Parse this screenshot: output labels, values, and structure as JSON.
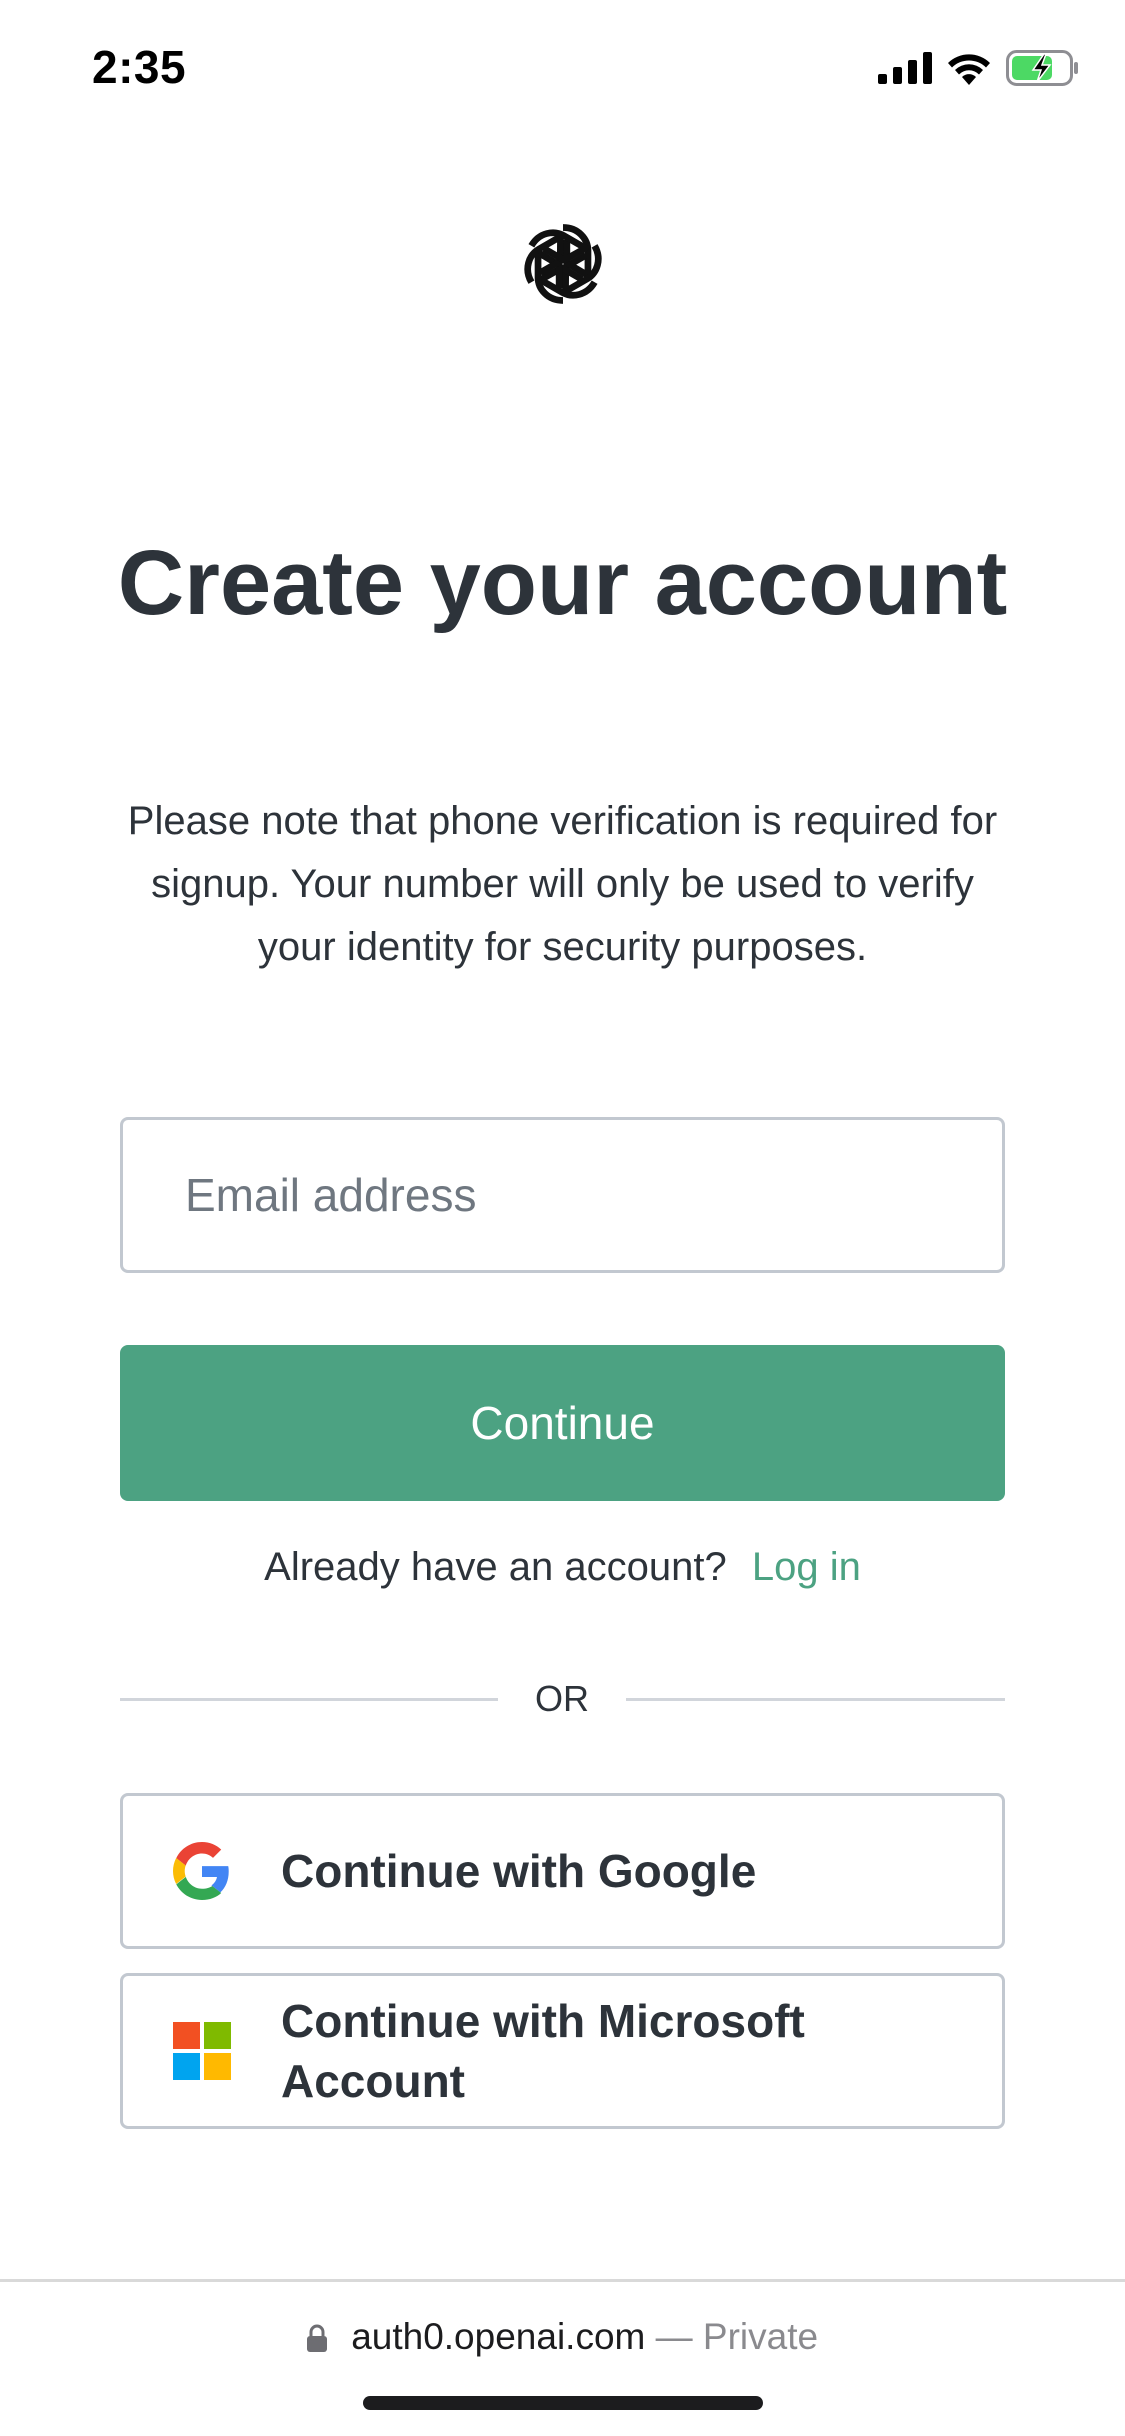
{
  "status_bar": {
    "time": "2:35",
    "icons": [
      "signal-icon",
      "wifi-icon",
      "battery-charging-icon"
    ],
    "battery_color": "#4cd964"
  },
  "logo": {
    "icon": "openai-logo-icon"
  },
  "heading": {
    "title": "Create your account",
    "subtitle": "Please note that phone verification is required for signup. Your number will only be used to verify your identity for security purposes."
  },
  "form": {
    "email_placeholder": "Email address",
    "email_value": "",
    "continue_label": "Continue",
    "accent_color": "#4ca282"
  },
  "login_prompt": {
    "text": "Already have an account?",
    "link_label": "Log in"
  },
  "divider": {
    "label": "OR"
  },
  "social": {
    "google_label": "Continue with Google",
    "microsoft_label": "Continue with Microsoft Account"
  },
  "browser_bar": {
    "domain": "auth0.openai.com",
    "privacy": "— Private"
  }
}
